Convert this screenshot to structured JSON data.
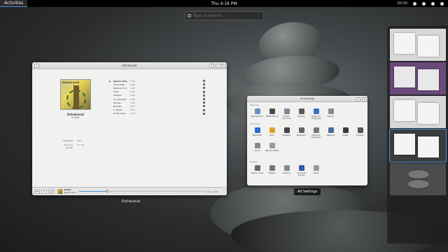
{
  "topbar": {
    "activities": "Activities",
    "clock": "Thu  4:16 PM",
    "status_time": "00:00"
  },
  "search": {
    "placeholder": "Type to search..."
  },
  "music": {
    "title": "ExtraLocal",
    "album_art_text": "ExtraLocal",
    "album_title": "ExtraLocal",
    "album_artist": "Aubais",
    "meta": [
      {
        "key": "Released",
        "value": "2011"
      },
      {
        "key": "Running Length",
        "value": "33 min"
      }
    ],
    "tracks": [
      {
        "name": "Spaces One",
        "dur": "3:56"
      },
      {
        "name": "Outsudden",
        "dur": "3:26"
      },
      {
        "name": "Natural Form",
        "dur": "2:52"
      },
      {
        "name": "Float",
        "dur": "3:25"
      },
      {
        "name": "Dreams",
        "dur": "3:09"
      },
      {
        "name": "Counterpart",
        "dur": "2:50"
      },
      {
        "name": "Paudes",
        "dur": "3:56"
      },
      {
        "name": "Bodolfe",
        "dur": "3:53"
      },
      {
        "name": "In Route",
        "dur": "3:57"
      },
      {
        "name": "Orders Now",
        "dur": "1:46"
      }
    ],
    "player": {
      "now_title": "Aubais",
      "now_track": "Spaces One",
      "time": "0:52 / 3:56",
      "progress": 0.22
    },
    "caption": "ExtraLocal"
  },
  "settings": {
    "title": "All Settings",
    "sections": [
      {
        "name": "Personal",
        "items": [
          {
            "label": "Background",
            "color": "#6b8fbf"
          },
          {
            "label": "Notifications",
            "color": "#4a4a4a"
          },
          {
            "label": "Online Accounts",
            "color": "#7a8a9a"
          },
          {
            "label": "Privacy",
            "color": "#5a5a5a"
          },
          {
            "label": "Region & Language",
            "color": "#3a6fc0"
          },
          {
            "label": "Search",
            "color": "#8a8a8a"
          }
        ]
      },
      {
        "name": "Hardware",
        "items": [
          {
            "label": "Bluetooth",
            "color": "#2a6ad0"
          },
          {
            "label": "Color",
            "color": "#e0a030"
          },
          {
            "label": "Displays",
            "color": "#444"
          },
          {
            "label": "Keyboard",
            "color": "#666"
          },
          {
            "label": "Mouse & Touchpad",
            "color": "#777"
          },
          {
            "label": "Network",
            "color": "#4a6a9a"
          },
          {
            "label": "Power",
            "color": "#3a3a3a"
          },
          {
            "label": "Printers",
            "color": "#555"
          },
          {
            "label": "Sound",
            "color": "#888"
          },
          {
            "label": "Wacom Tablet",
            "color": "#999"
          }
        ]
      },
      {
        "name": "System",
        "items": [
          {
            "label": "Date & Time",
            "color": "#666"
          },
          {
            "label": "Details",
            "color": "#777"
          },
          {
            "label": "Sharing",
            "color": "#888"
          },
          {
            "label": "Universal Access",
            "color": "#2a5ab0"
          },
          {
            "label": "Users",
            "color": "#999"
          }
        ]
      }
    ],
    "caption": "All Settings"
  },
  "workspaces": [
    {
      "name": "workspace-1",
      "bg": "#d8d8d8"
    },
    {
      "name": "workspace-2",
      "bg": "#6a4a7a"
    },
    {
      "name": "workspace-3",
      "bg": "#d8d8d8"
    },
    {
      "name": "workspace-4",
      "bg": "#3a3c3d"
    },
    {
      "name": "workspace-5",
      "bg": "#4a4c4d"
    }
  ]
}
